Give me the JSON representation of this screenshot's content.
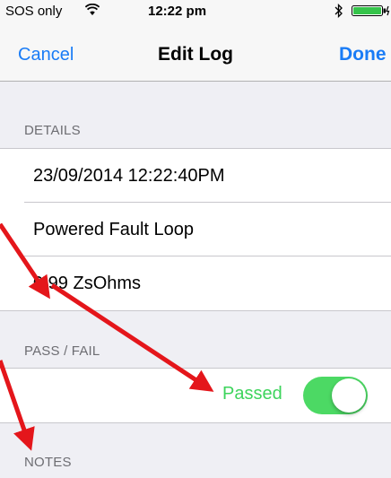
{
  "status_bar": {
    "carrier": "SOS only",
    "time": "12:22 pm"
  },
  "nav": {
    "cancel_label": "Cancel",
    "title": "Edit Log",
    "done_label": "Done"
  },
  "details": {
    "header": "DETAILS",
    "rows": [
      "23/09/2014 12:22:40PM",
      "Powered Fault Loop",
      "0.99 ZsOhms"
    ]
  },
  "pass_fail": {
    "header": "PASS / FAIL",
    "status_label": "Passed",
    "toggle_on": true
  },
  "notes": {
    "header": "NOTES"
  },
  "colors": {
    "accent_blue": "#1a7cf6",
    "pass_green": "#3dd45c",
    "toggle_green": "#4cd964",
    "annotation_red": "#e4161b"
  },
  "icons": [
    "wifi-icon",
    "bluetooth-icon",
    "battery-icon"
  ]
}
